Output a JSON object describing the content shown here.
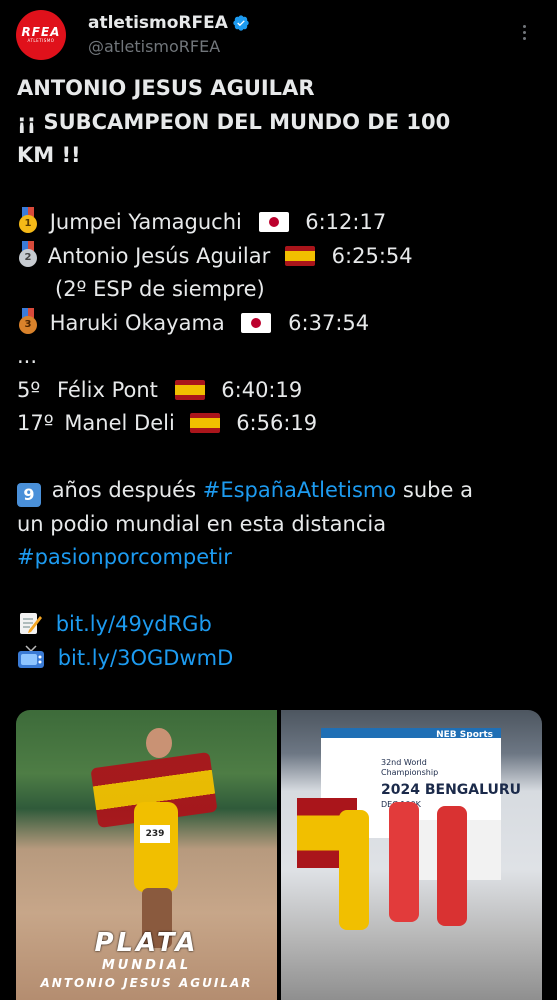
{
  "tweet": {
    "author": {
      "display_name": "atletismoRFEA",
      "handle": "@atletismoRFEA",
      "avatar_logo_text": "RFEA",
      "avatar_sub_text": "ATLETISMO",
      "verified": true
    },
    "title_lines": [
      "ANTONIO JESUS AGUILAR",
      "¡¡ SUBCAMPEON DEL MUNDO DE 100",
      "KM !!"
    ],
    "results": [
      {
        "medal": "gold",
        "medal_num": "1",
        "name": "Jumpei Yamaguchi",
        "flag": "jp",
        "time": "6:12:17"
      },
      {
        "medal": "silver",
        "medal_num": "2",
        "name": "Antonio Jesús Aguilar",
        "flag": "es",
        "time": "6:25:54",
        "note": "(2º ESP de siempre)"
      },
      {
        "medal": "bronze",
        "medal_num": "3",
        "name": "Haruki Okayama",
        "flag": "jp",
        "time": "6:37:54"
      }
    ],
    "ellipsis": "...",
    "others": [
      {
        "place": "5º",
        "name": "Félix Pont",
        "flag": "es",
        "time": "6:40:19"
      },
      {
        "place": "17º",
        "name": "Manel Deli",
        "flag": "es",
        "time": "6:56:19"
      }
    ],
    "paragraph": {
      "keycap": "9",
      "pre": "años después",
      "hashtag1": "#EspañaAtletismo",
      "post1": "sube a",
      "line2": "un podio mundial en esta distancia",
      "hashtag2": "#pasionporcompetir"
    },
    "links": [
      {
        "icon": "memo-icon",
        "url": "bit.ly/49ydRGb"
      },
      {
        "icon": "tv-icon",
        "url": "bit.ly/3OGDwmD"
      }
    ],
    "media": {
      "left": {
        "title": "PLATA",
        "subtitle": "MUNDIAL",
        "name": "ANTONIO JESUS AGUILAR",
        "bib": "239"
      },
      "right": {
        "brand": "NEB Sports",
        "banner_line1": "32nd World",
        "banner_line2": "Championship",
        "banner_big": "2024 BENGALURU",
        "banner_sub": "DEC 100K"
      }
    }
  },
  "colors": {
    "background": "#000000",
    "text": "#e7e9ea",
    "secondary": "#71767b",
    "link": "#1d9bf0",
    "brand_red": "#e0111b"
  }
}
